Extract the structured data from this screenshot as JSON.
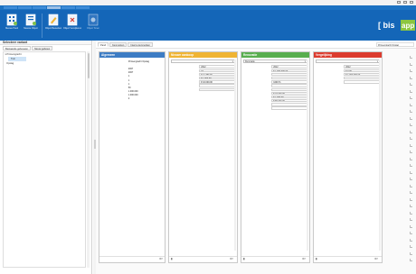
{
  "window": {
    "title": ""
  },
  "ribbon_tabs": [
    "",
    "",
    "",
    "",
    "",
    ""
  ],
  "ribbon": {
    "buttons": [
      {
        "label": "Nieuwe Pand",
        "icon": "new-building-icon"
      },
      {
        "label": "Nieuwe Object",
        "icon": "new-object-icon"
      },
      {
        "label": "Object Bewerken",
        "icon": "edit-object-icon"
      },
      {
        "label": "Object Verwijderen",
        "icon": "delete-object-icon"
      },
      {
        "label": "Object Tonen",
        "icon": "show-object-icon"
      }
    ],
    "logo_text": "[ bis app"
  },
  "left_panel": {
    "header": "Selecteer variant",
    "tabs": [
      "Bestaande gebouwen",
      "Nieuw gebouw"
    ],
    "items": [
      "Prinsengracht",
      "Tuin",
      "Opslag",
      "",
      "",
      "",
      "",
      "",
      "",
      "",
      "",
      "",
      "",
      "",
      "",
      "",
      "",
      "",
      "",
      "",
      "",
      "",
      "",
      "",
      "",
      "",
      "",
      "",
      "",
      "",
      "",
      "",
      "",
      "",
      "",
      "",
      "",
      "",
      "",
      "",
      "",
      "",
      "",
      "",
      "",
      ""
    ]
  },
  "main": {
    "tabs": [
      "Pand",
      "Kenmerken",
      "Interne kenmerken"
    ],
    "breadcrumb": "Prinsengracht Opslag",
    "cards": [
      {
        "title": "Algemeen",
        "color": "#3d7cc4",
        "fields": [
          {
            "label": "",
            "value": "Prinsengracht Opslag"
          },
          {
            "label": "",
            "value": ""
          },
          {
            "label": "",
            "value": "2007"
          },
          {
            "label": "",
            "value": "2007"
          },
          {
            "label": "",
            "value": "1"
          },
          {
            "label": "",
            "value": "1"
          },
          {
            "label": "",
            "value": "1"
          },
          {
            "label": "",
            "value": "50"
          },
          {
            "label": "",
            "value": "1.000.000"
          },
          {
            "label": "",
            "value": "1.000.000"
          },
          {
            "label": "",
            "value": "2"
          }
        ]
      },
      {
        "title": "Nieuwe aankoop",
        "color": "#f0b433",
        "dropdown": "",
        "fields": [
          {
            "label": "",
            "value": "2012"
          },
          {
            "label": "",
            "value": "10"
          },
          {
            "label": "",
            "value": "€ 11.750,00"
          },
          {
            "label": "",
            "value": "€ 1.000,00"
          },
          {
            "label": "",
            "value": "€ 10.000,00"
          },
          {
            "label": "",
            "value": ""
          },
          {
            "label": "",
            "value": ""
          }
        ]
      },
      {
        "title": "Renovatie",
        "color": "#58ae4f",
        "dropdown": "Renovatie",
        "fields": [
          {
            "label": "",
            "value": "2012"
          },
          {
            "label": "",
            "value": "€ 1.000.000,00"
          },
          {
            "label": "",
            "value": ""
          },
          {
            "label": "",
            "value": ""
          },
          {
            "label": "",
            "value": "1000 %"
          },
          {
            "label": "",
            "value": ""
          },
          {
            "label": "",
            "value": ""
          },
          {
            "label": "",
            "value": "€ 10.000,00"
          },
          {
            "label": "",
            "value": "€ 1.000,00"
          },
          {
            "label": "",
            "value": "€ 50.000,00"
          },
          {
            "label": "",
            "value": ""
          },
          {
            "label": "",
            "value": ""
          }
        ]
      },
      {
        "title": "Vergelijking",
        "color": "#dc3b2e",
        "dropdown": "",
        "fields": [
          {
            "label": "",
            "value": "2012"
          },
          {
            "label": "",
            "value": "€ 0,00"
          },
          {
            "label": "",
            "value": "€ 1.000.000,00"
          },
          {
            "label": "",
            "value": ""
          },
          {
            "label": "",
            "value": ""
          }
        ]
      }
    ]
  }
}
